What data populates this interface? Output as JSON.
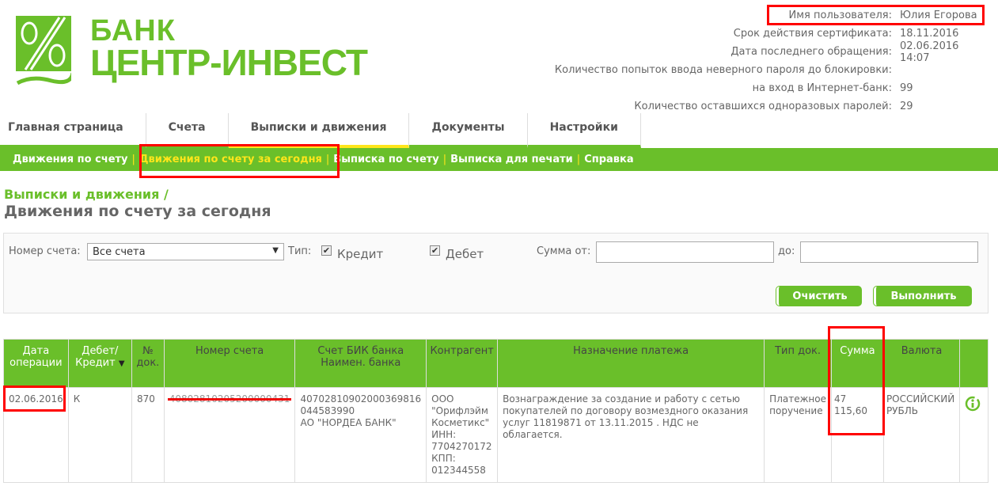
{
  "logo": {
    "line1": "БАНК",
    "line2": "ЦЕНТР-ИНВЕСТ"
  },
  "userinfo": [
    {
      "k": "Имя пользователя:",
      "v": "Юлия Егорова"
    },
    {
      "k": "Срок действия сертификата:",
      "v": "18.11.2016"
    },
    {
      "k": "Дата последнего обращения:",
      "v": "02.06.2016 14:07"
    },
    {
      "k": "Количество попыток ввода неверного пароля до блокировки:",
      "v": ""
    },
    {
      "k": "на вход в Интернет-банк:",
      "v": "99"
    },
    {
      "k": "Количество оставшихся одноразовых паролей:",
      "v": "29"
    }
  ],
  "tabs": [
    "Главная страница",
    "Счета",
    "Выписки и движения",
    "Документы",
    "Настройки"
  ],
  "subnav": [
    "Движения по счету",
    "Движения по счету за сегодня",
    "Выписка по счету",
    "Выписка для печати",
    "Справка"
  ],
  "subnav_sep": "|",
  "breadcrumb": "Выписки и движения /",
  "title": "Движения по счету за сегодня",
  "filter": {
    "account_label": "Номер счета:",
    "account_value": "Все счета",
    "type_label": "Тип:",
    "credit": "Кредит",
    "debit": "Дебет",
    "sum_from": "Сумма от:",
    "sum_to": "до:",
    "clear": "Очистить",
    "run": "Выполнить"
  },
  "table": {
    "headers": [
      "Дата операции",
      "Дебет/ Кредит",
      "№ док.",
      "Номер счета",
      "Счет БИК банка Наимен. банка",
      "Контрагент",
      "Назначение платежа",
      "Тип док.",
      "Сумма",
      "Валюта",
      ""
    ],
    "rows": [
      {
        "date": "02.06.2016",
        "dc": "К",
        "doc": "870",
        "account": "40802810205200000431",
        "acc_line1": "40702810902000369816",
        "acc_line2": "044583990",
        "acc_line3": "АО \"НОРДЕА БАНК\"",
        "counterparty": "ООО \"Орифлэйм Косметикс\" ИНН: 7704270172 КПП: 012344558",
        "purpose": "Вознаграждение за создание и работу с сетью покупателей по договору возмездного оказания услуг 11819871 от 13.11.2015 . НДС не облагается.",
        "doc_type": "Платежное поручение",
        "amount": "47 115,60",
        "currency": "РОССИЙСКИЙ РУБЛЬ"
      }
    ]
  },
  "colors": {
    "green": "#6abf2a",
    "yellow": "#ffe61a"
  }
}
